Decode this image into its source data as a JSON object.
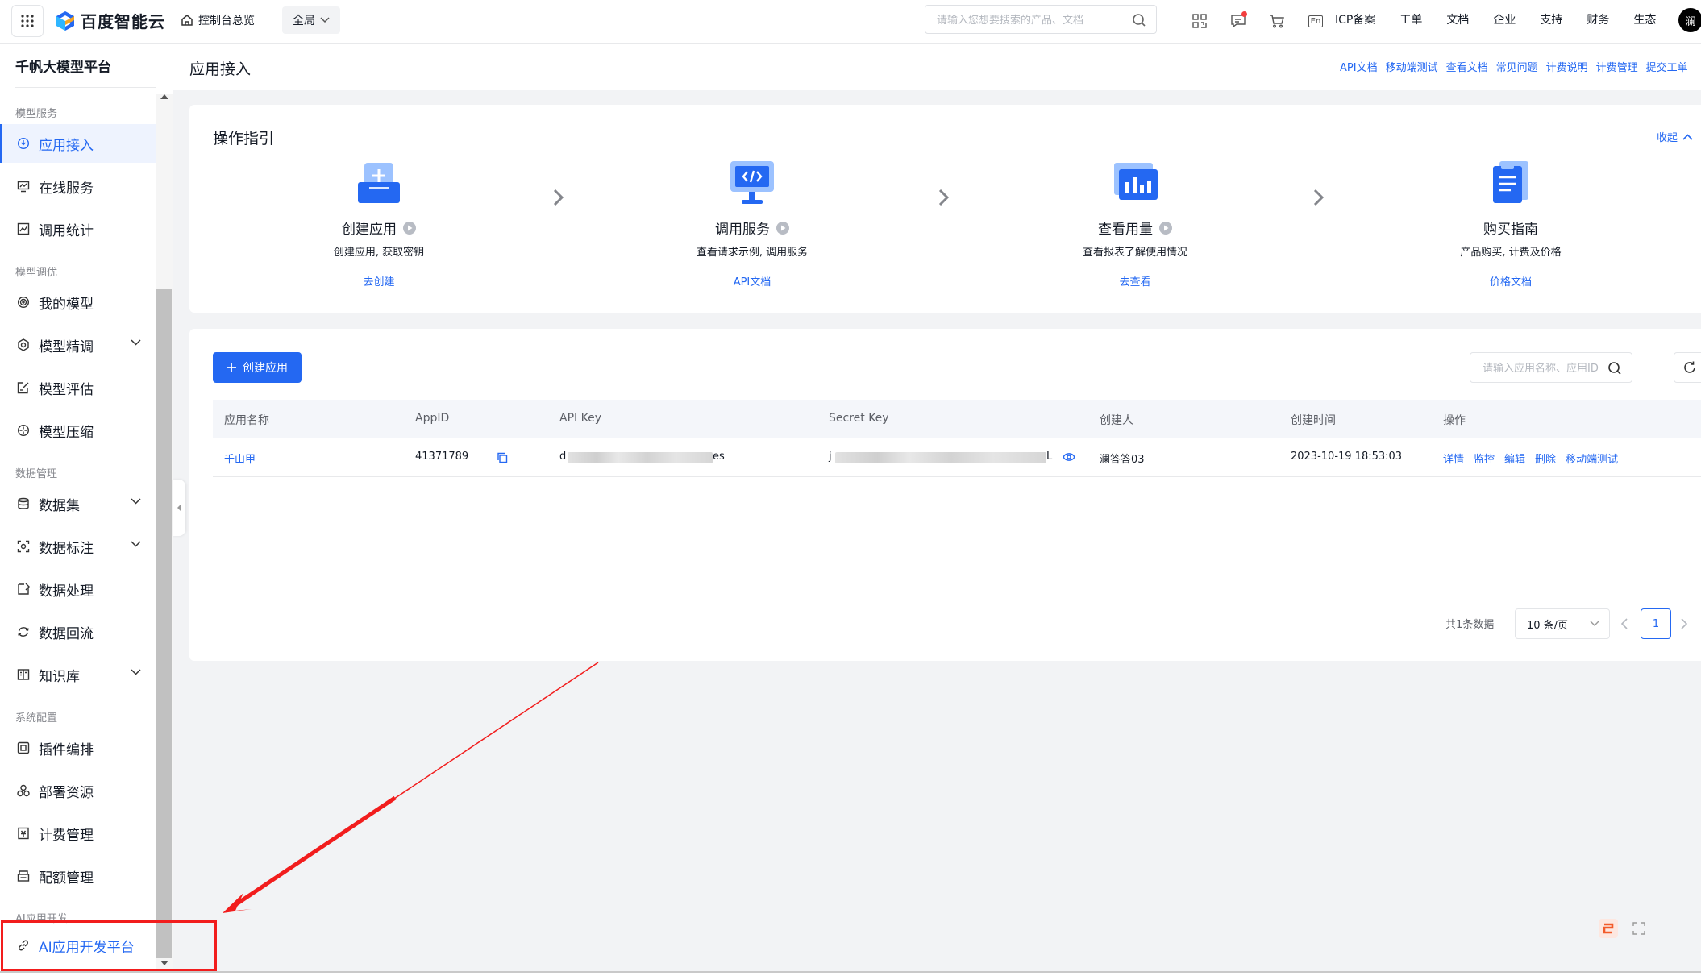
{
  "topbar": {
    "brand": "百度智能云",
    "console": "控制台总览",
    "region": "全局",
    "search_placeholder": "请输入您想要搜索的产品、文档",
    "menu": [
      "ICP备案",
      "工单",
      "文档",
      "企业",
      "支持",
      "财务",
      "生态"
    ],
    "en_label": "En",
    "avatar": "澜"
  },
  "sidebar": {
    "title": "千帆大模型平台",
    "groups": {
      "model_service": "模型服务",
      "model_tuning": "模型调优",
      "data_mgmt": "数据管理",
      "system": "系统配置",
      "ai_dev": "AI应用开发"
    },
    "items": {
      "app_access": "应用接入",
      "online_service": "在线服务",
      "call_stats": "调用统计",
      "my_models": "我的模型",
      "fine_tune": "模型精调",
      "evaluate": "模型评估",
      "compress": "模型压缩",
      "datasets": "数据集",
      "labeling": "数据标注",
      "processing": "数据处理",
      "reflow": "数据回流",
      "knowledge": "知识库",
      "plugins": "插件编排",
      "deploy": "部署资源",
      "billing": "计费管理",
      "quota": "配额管理",
      "ai_platform": "AI应用开发平台"
    }
  },
  "page": {
    "title": "应用接入",
    "links": [
      "API文档",
      "移动端测试",
      "查看文档",
      "常见问题",
      "计费说明",
      "计费管理",
      "提交工单"
    ]
  },
  "guide": {
    "title": "操作指引",
    "collapse": "收起",
    "steps": [
      {
        "name": "创建应用",
        "desc": "创建应用, 获取密钥",
        "link": "去创建"
      },
      {
        "name": "调用服务",
        "desc": "查看请求示例, 调用服务",
        "link": "API文档"
      },
      {
        "name": "查看用量",
        "desc": "查看报表了解使用情况",
        "link": "去查看"
      },
      {
        "name": "购买指南",
        "desc": "产品购买, 计费及价格",
        "link": "价格文档"
      }
    ]
  },
  "list": {
    "create_label": "创建应用",
    "search_placeholder": "请输入应用名称、应用ID",
    "columns": [
      "应用名称",
      "AppID",
      "API Key",
      "Secret Key",
      "创建人",
      "创建时间",
      "操作"
    ],
    "rows": [
      {
        "name": "千山甲",
        "appid": "41371789",
        "api_key_start": "d",
        "api_key_end": "es",
        "secret_start": "j",
        "secret_end": "L",
        "creator": "澜答答03",
        "created": "2023-10-19 18:53:03",
        "ops": [
          "详情",
          "监控",
          "编辑",
          "删除",
          "移动端测试"
        ]
      }
    ],
    "total": "共1条数据",
    "page_size": "10 条/页",
    "page": "1"
  },
  "colors": {
    "primary": "#2468f2",
    "highlight": "#f21d1d",
    "sidebar_active_bg": "#eef3fe"
  }
}
